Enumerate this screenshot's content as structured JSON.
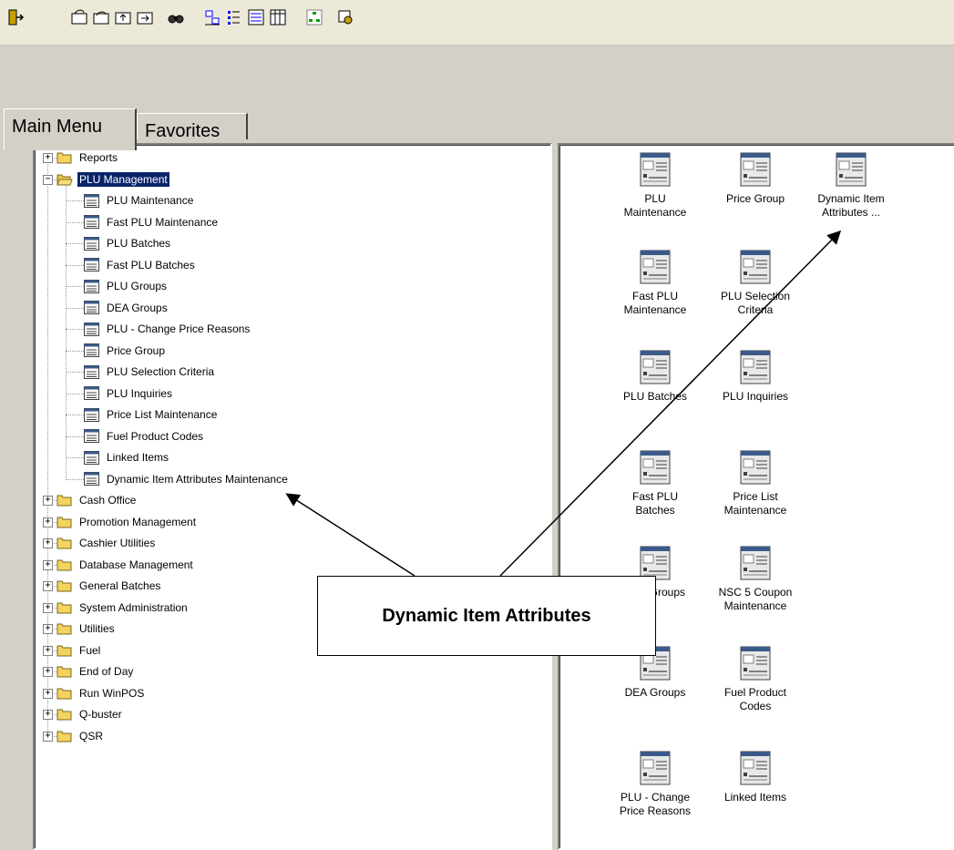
{
  "toolbar": {
    "buttons": [
      {
        "icon": "exit-icon"
      },
      {
        "icon": "open-icon"
      },
      {
        "icon": "open-folder-icon"
      },
      {
        "icon": "up-folder-icon"
      },
      {
        "icon": "forward-folder-icon"
      },
      {
        "icon": "find-icon"
      },
      {
        "icon": "large-icons-view-icon"
      },
      {
        "icon": "small-icons-view-icon"
      },
      {
        "icon": "list-view-icon"
      },
      {
        "icon": "details-view-icon"
      },
      {
        "icon": "tree-view-icon"
      },
      {
        "icon": "help-icon"
      }
    ]
  },
  "tabs": [
    {
      "label": "Main Menu",
      "active": true
    },
    {
      "label": "Favorites",
      "active": false
    }
  ],
  "tree": {
    "items": [
      {
        "label": "Reports",
        "type": "folder",
        "expander": "+"
      },
      {
        "label": "PLU Management",
        "type": "folder-open",
        "expander": "−",
        "selected": true
      },
      {
        "label": "PLU Maintenance",
        "type": "doc"
      },
      {
        "label": "Fast PLU Maintenance",
        "type": "doc"
      },
      {
        "label": "PLU Batches",
        "type": "doc"
      },
      {
        "label": "Fast PLU Batches",
        "type": "doc"
      },
      {
        "label": "PLU Groups",
        "type": "doc"
      },
      {
        "label": "DEA Groups",
        "type": "doc"
      },
      {
        "label": "PLU - Change Price Reasons",
        "type": "doc"
      },
      {
        "label": "Price Group",
        "type": "doc"
      },
      {
        "label": "PLU Selection Criteria",
        "type": "doc"
      },
      {
        "label": "PLU Inquiries",
        "type": "doc"
      },
      {
        "label": "Price List Maintenance",
        "type": "doc"
      },
      {
        "label": "Fuel Product Codes",
        "type": "doc"
      },
      {
        "label": "Linked Items",
        "type": "doc"
      },
      {
        "label": "Dynamic Item Attributes Maintenance",
        "type": "doc"
      },
      {
        "label": "Cash Office",
        "type": "folder",
        "expander": "+"
      },
      {
        "label": "Promotion Management",
        "type": "folder",
        "expander": "+"
      },
      {
        "label": "Cashier Utilities",
        "type": "folder",
        "expander": "+"
      },
      {
        "label": "Database Management",
        "type": "folder",
        "expander": "+"
      },
      {
        "label": "General Batches",
        "type": "folder",
        "expander": "+"
      },
      {
        "label": "System Administration",
        "type": "folder",
        "expander": "+"
      },
      {
        "label": "Utilities",
        "type": "folder",
        "expander": "+"
      },
      {
        "label": "Fuel",
        "type": "folder",
        "expander": "+"
      },
      {
        "label": "End of Day",
        "type": "folder",
        "expander": "+"
      },
      {
        "label": "Run WinPOS",
        "type": "folder",
        "expander": "+"
      },
      {
        "label": "Q-buster",
        "type": "folder",
        "expander": "+"
      },
      {
        "label": "QSR",
        "type": "folder",
        "expander": "+"
      }
    ]
  },
  "icons": {
    "items": [
      {
        "line1": "PLU",
        "line2": "Maintenance"
      },
      {
        "line1": "Price Group",
        "line2": ""
      },
      {
        "line1": "Dynamic Item",
        "line2": "Attributes ..."
      },
      {
        "line1": "Fast PLU",
        "line2": "Maintenance"
      },
      {
        "line1": "PLU Selection",
        "line2": "Criteria"
      },
      {
        "line1": "PLU Batches",
        "line2": ""
      },
      {
        "line1": "PLU Inquiries",
        "line2": ""
      },
      {
        "line1": "Fast PLU",
        "line2": "Batches"
      },
      {
        "line1": "Price List",
        "line2": "Maintenance"
      },
      {
        "line1": "PLU Groups",
        "line2": ""
      },
      {
        "line1": "NSC 5 Coupon",
        "line2": "Maintenance"
      },
      {
        "line1": "DEA Groups",
        "line2": ""
      },
      {
        "line1": "Fuel Product",
        "line2": "Codes"
      },
      {
        "line1": "PLU - Change",
        "line2": "Price Reasons"
      },
      {
        "line1": "Linked Items",
        "line2": ""
      }
    ]
  },
  "callout": {
    "text": "Dynamic Item Attributes"
  },
  "colors": {
    "selection": "#0a246a",
    "folder": "#f4d35e",
    "chrome": "#d4d0c8"
  }
}
